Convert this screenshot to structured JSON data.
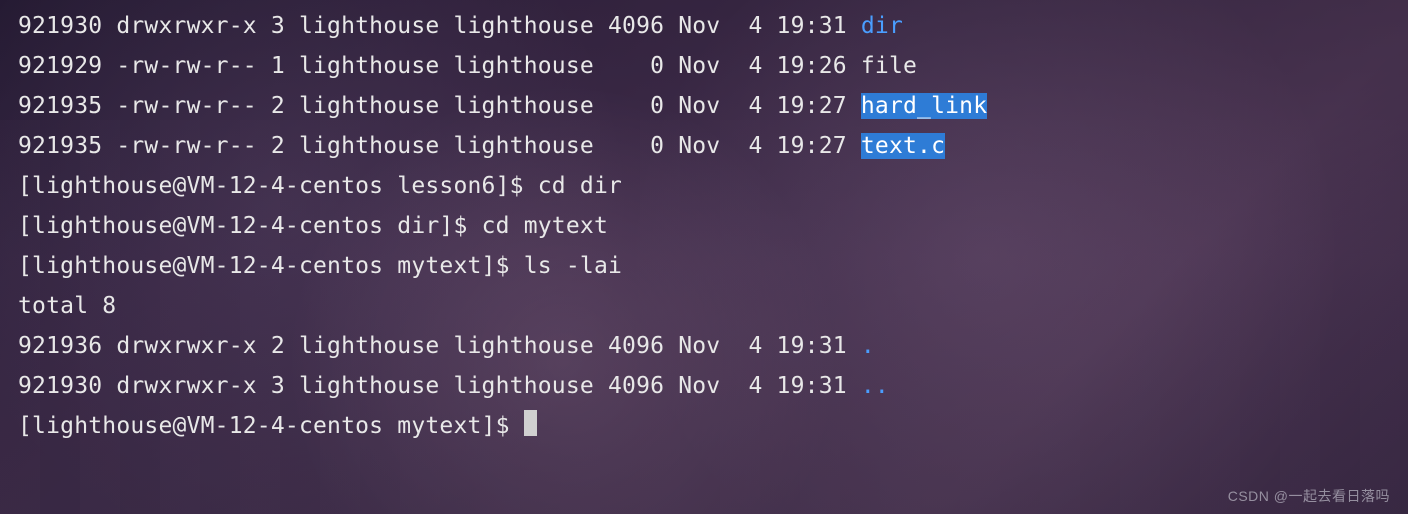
{
  "listing1": [
    {
      "inode": "921930",
      "perms": "drwxrwxr-x",
      "links": "3",
      "owner": "lighthouse",
      "group": "lighthouse",
      "size": "4096",
      "month": "Nov",
      "day": " 4",
      "time": "19:31",
      "name": "dir",
      "cls": "dir-color"
    },
    {
      "inode": "921929",
      "perms": "-rw-rw-r--",
      "links": "1",
      "owner": "lighthouse",
      "group": "lighthouse",
      "size": "   0",
      "month": "Nov",
      "day": " 4",
      "time": "19:26",
      "name": "file",
      "cls": ""
    },
    {
      "inode": "921935",
      "perms": "-rw-rw-r--",
      "links": "2",
      "owner": "lighthouse",
      "group": "lighthouse",
      "size": "   0",
      "month": "Nov",
      "day": " 4",
      "time": "19:27",
      "name": "hard_link",
      "cls": "selected"
    },
    {
      "inode": "921935",
      "perms": "-rw-rw-r--",
      "links": "2",
      "owner": "lighthouse",
      "group": "lighthouse",
      "size": "   0",
      "month": "Nov",
      "day": " 4",
      "time": "19:27",
      "name": "text.c",
      "cls": "selected"
    }
  ],
  "prompts": [
    {
      "prefix": "[lighthouse@VM-12-4-centos lesson6]$ ",
      "cmd": "cd dir"
    },
    {
      "prefix": "[lighthouse@VM-12-4-centos dir]$ ",
      "cmd": "cd mytext"
    },
    {
      "prefix": "[lighthouse@VM-12-4-centos mytext]$ ",
      "cmd": "ls -lai"
    }
  ],
  "total_line": "total 8",
  "listing2": [
    {
      "inode": "921936",
      "perms": "drwxrwxr-x",
      "links": "2",
      "owner": "lighthouse",
      "group": "lighthouse",
      "size": "4096",
      "month": "Nov",
      "day": " 4",
      "time": "19:31",
      "name": ".",
      "cls": "dir-color"
    },
    {
      "inode": "921930",
      "perms": "drwxrwxr-x",
      "links": "3",
      "owner": "lighthouse",
      "group": "lighthouse",
      "size": "4096",
      "month": "Nov",
      "day": " 4",
      "time": "19:31",
      "name": "..",
      "cls": "dir-color"
    }
  ],
  "final_prompt": "[lighthouse@VM-12-4-centos mytext]$ ",
  "watermark": "CSDN @一起去看日落吗"
}
